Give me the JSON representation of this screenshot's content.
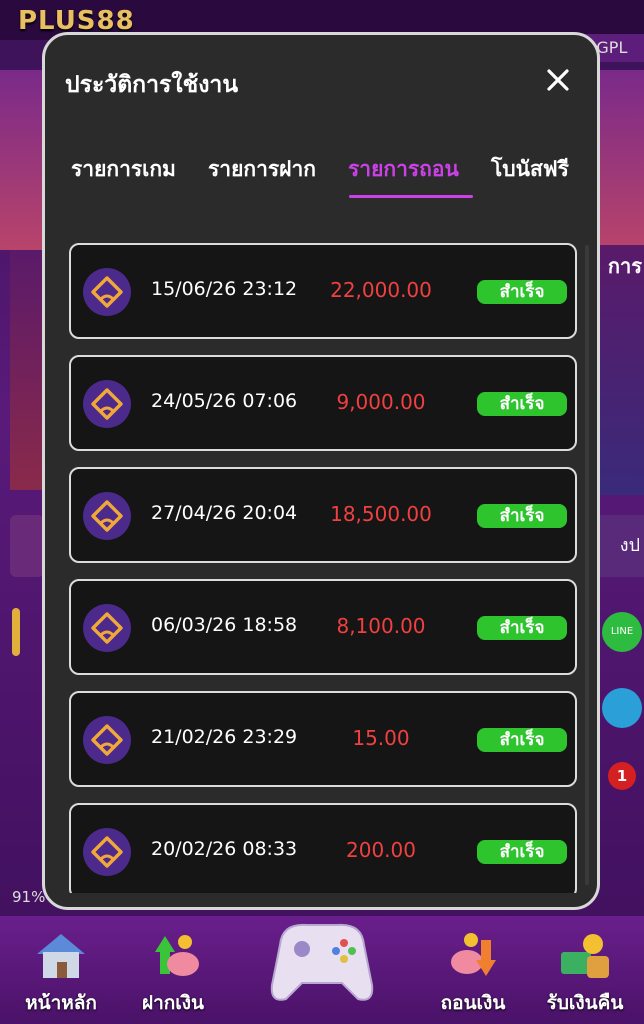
{
  "background": {
    "logo": "PLUS88",
    "right_tab": "GGPL",
    "right_text": "การ",
    "right_button": "งป",
    "line_label": "LINE",
    "badge_count": "1",
    "progress_text": "91%"
  },
  "modal": {
    "title": "ประวัติการใช้งาน",
    "tabs": [
      {
        "label": "รายการเกม",
        "active": false
      },
      {
        "label": "รายการฝาก",
        "active": false
      },
      {
        "label": "รายการถอน",
        "active": true
      },
      {
        "label": "โบนัสฟรี",
        "active": false
      }
    ],
    "rows": [
      {
        "date": "15/06/26 23:12",
        "amount": "22,000.00",
        "status": "สำเร็จ"
      },
      {
        "date": "24/05/26 07:06",
        "amount": "9,000.00",
        "status": "สำเร็จ"
      },
      {
        "date": "27/04/26 20:04",
        "amount": "18,500.00",
        "status": "สำเร็จ"
      },
      {
        "date": "06/03/26 18:58",
        "amount": "8,100.00",
        "status": "สำเร็จ"
      },
      {
        "date": "21/02/26 23:29",
        "amount": "15.00",
        "status": "สำเร็จ"
      },
      {
        "date": "20/02/26 08:33",
        "amount": "200.00",
        "status": "สำเร็จ"
      }
    ]
  },
  "bottom_nav": {
    "items": [
      {
        "label": "หน้าหลัก",
        "icon": "home-icon"
      },
      {
        "label": "ฝากเงิน",
        "icon": "deposit-piggy-icon"
      },
      {
        "label": "ถอนเงิน",
        "icon": "withdraw-piggy-icon"
      },
      {
        "label": "รับเงินคืน",
        "icon": "cashback-icon"
      }
    ]
  },
  "colors": {
    "accent": "#cc40e8",
    "amount": "#f04040",
    "success": "#2ec42e",
    "bank_icon_bg": "#4b2a8c"
  }
}
